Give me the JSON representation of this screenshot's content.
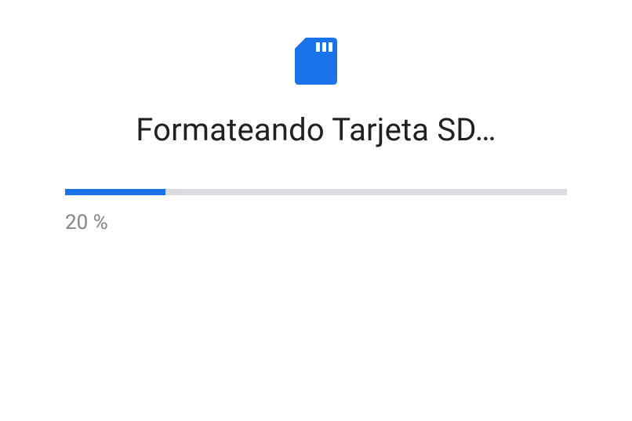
{
  "title": "Formateando Tarjeta SD…",
  "progress": {
    "percent_value": 20,
    "percent_label": "20 %"
  },
  "colors": {
    "accent": "#1a73e8",
    "track": "#dadce0",
    "title_text": "#202124",
    "percent_text": "#80868b"
  },
  "icon": {
    "name": "sd-card-icon"
  }
}
